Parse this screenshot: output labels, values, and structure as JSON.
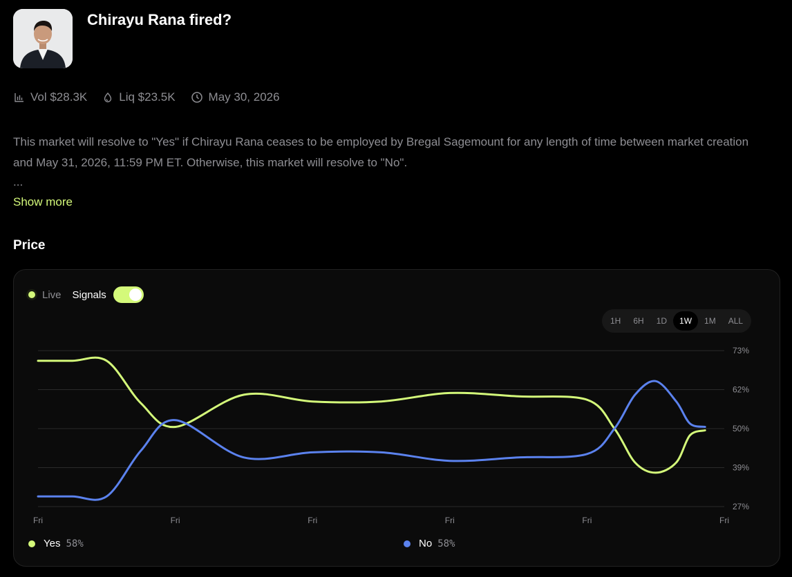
{
  "market": {
    "title": "Chirayu Rana fired?",
    "volume": "Vol $28.3K",
    "liquidity": "Liq $23.5K",
    "end_date": "May 30, 2026",
    "description": "This market will resolve to \"Yes\" if Chirayu Rana ceases to be employed by Bregal Sagemount for any length of time between market creation and May 31, 2026, 11:59 PM ET. Otherwise, this market will resolve to \"No\".",
    "ellipsis": "...",
    "show_more": "Show more"
  },
  "section": {
    "price_title": "Price"
  },
  "controls": {
    "live_label": "Live",
    "signals_label": "Signals",
    "signals_on": true,
    "ranges": [
      "1H",
      "6H",
      "1D",
      "1W",
      "1M",
      "ALL"
    ],
    "active_range": "1W"
  },
  "colors": {
    "yes": "#d4f97a",
    "no": "#5b82ee",
    "accent": "#d4f97a",
    "grid": "#2a2a2a"
  },
  "icons": {
    "volume": "bar-chart-icon",
    "liquidity": "droplet-icon",
    "date": "clock-icon"
  },
  "legend": [
    {
      "name": "Yes",
      "value": "58%"
    },
    {
      "name": "No",
      "value": "58%"
    }
  ],
  "chart_data": {
    "type": "line",
    "xlabels": [
      "Fri",
      "Fri",
      "Fri",
      "Fri",
      "Fri",
      "Fri"
    ],
    "yticks": [
      "73%",
      "62%",
      "50%",
      "39%",
      "27%"
    ],
    "ylim": [
      27,
      73
    ],
    "grid": true,
    "x": [
      0,
      0.25,
      0.5,
      0.75,
      1.0,
      1.5,
      2.0,
      2.5,
      3.0,
      3.5,
      4.0,
      4.2,
      4.35,
      4.5,
      4.65,
      4.75,
      4.86
    ],
    "series": [
      {
        "name": "Yes",
        "values": [
          70,
          70,
          70,
          57.5,
          50.5,
          60,
          58,
          58,
          60.5,
          59.5,
          58.5,
          50,
          40,
          37,
          40,
          48,
          49.5
        ]
      },
      {
        "name": "No",
        "values": [
          30,
          30,
          30,
          43.5,
          52.5,
          41.5,
          43,
          43,
          40.5,
          41.5,
          42.5,
          50,
          60,
          64,
          58,
          51.5,
          50.5
        ]
      }
    ]
  }
}
